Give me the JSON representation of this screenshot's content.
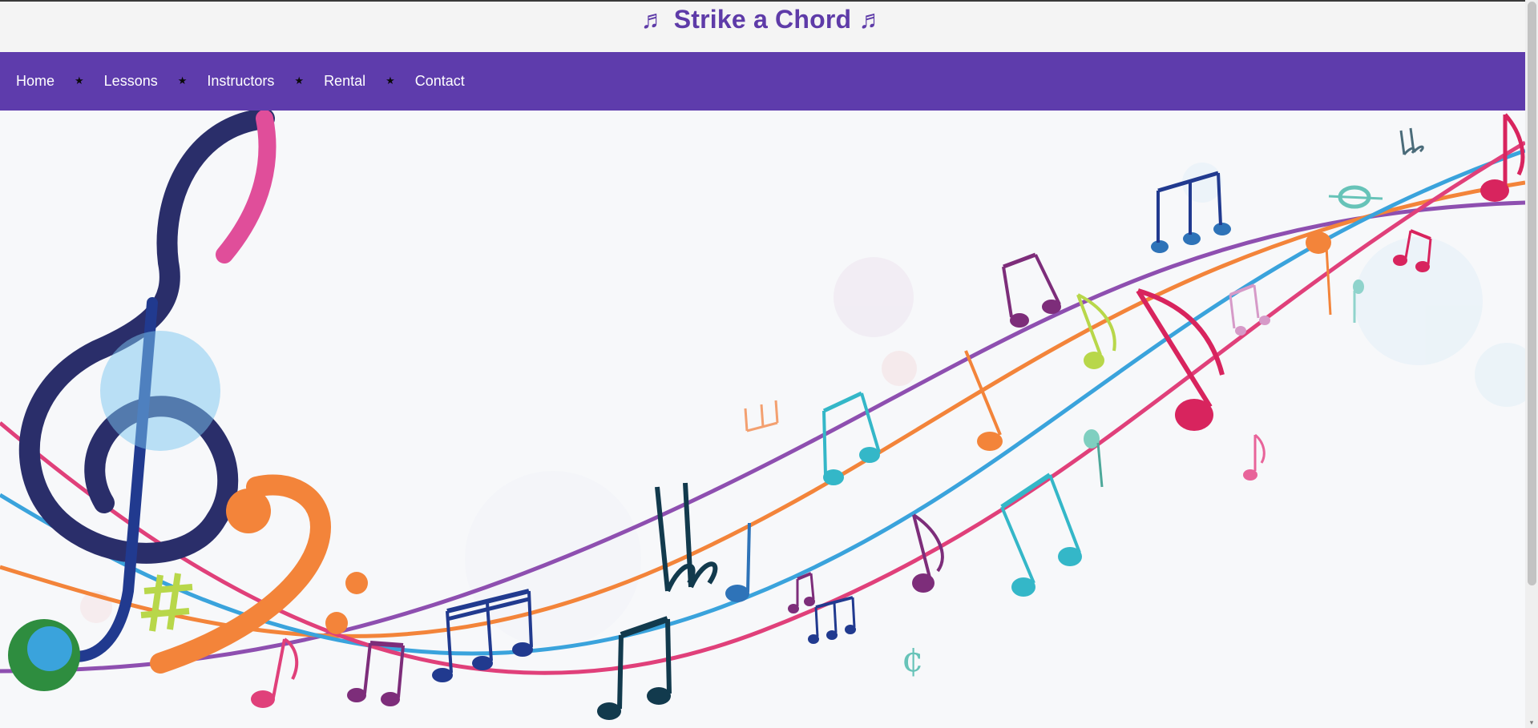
{
  "header": {
    "title": "♬ Strike a Chord ♬"
  },
  "nav": {
    "items": [
      {
        "label": "Home"
      },
      {
        "label": "Lessons"
      },
      {
        "label": "Instructors"
      },
      {
        "label": "Rental"
      },
      {
        "label": "Contact"
      }
    ],
    "separator": "★"
  },
  "hero": {
    "image": "colorful-music-notes-banner",
    "colors": {
      "purple": "#8e4fb0",
      "orange": "#f3843a",
      "blue": "#3aa3dc",
      "pink": "#e0407a",
      "teal": "#34b7c8",
      "navy": "#213a8f",
      "lime": "#b8d74a"
    }
  },
  "theme": {
    "accent": "#5e3cac",
    "title_color": "#5e3ba8",
    "nav_text": "#ffffff",
    "background": "#f4f4f4"
  }
}
